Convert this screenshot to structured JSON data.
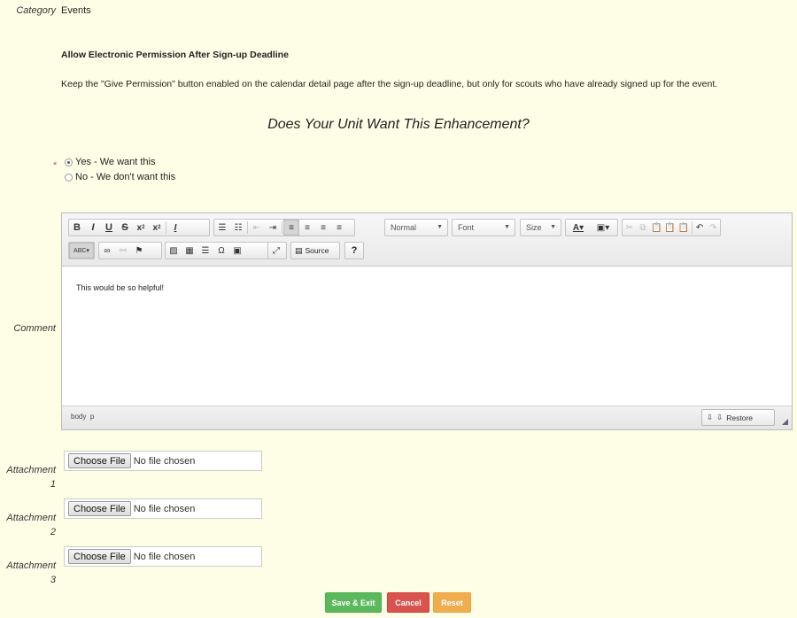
{
  "category": {
    "label": "Category",
    "value": "Events"
  },
  "enhancement": {
    "title": "Allow Electronic Permission After Sign-up Deadline",
    "description": "Keep the \"Give Permission\" button enabled on the calendar detail page after the sign-up deadline, but only for scouts who have already signed up for the event."
  },
  "question": "Does Your Unit Want This Enhancement?",
  "required_marker": "*",
  "options": [
    {
      "label": "Yes - We want this",
      "selected": true
    },
    {
      "label": "No - We don't want this",
      "selected": false
    }
  ],
  "comment": {
    "label": "Comment",
    "toolbar": {
      "format_combo": "Normal",
      "font_combo": "Font",
      "size_combo": "Size",
      "source_label": "Source",
      "help_label": "?",
      "buttons": [
        "bold",
        "italic",
        "underline",
        "strikethrough",
        "subscript",
        "superscript",
        "remove-format",
        "numbered-list",
        "bulleted-list",
        "outdent",
        "indent",
        "align-left",
        "align-center",
        "align-right",
        "justify",
        "text-color",
        "background-color",
        "cut",
        "copy",
        "paste",
        "paste-text",
        "paste-word",
        "undo",
        "redo",
        "spellcheck",
        "link",
        "unlink",
        "anchor",
        "image",
        "table",
        "horizontal-line",
        "special-char",
        "youtube",
        "maximize",
        "source",
        "help"
      ]
    },
    "body_text": "This would be so helpful!",
    "path": [
      "body",
      "p"
    ],
    "restore_label": "Restore"
  },
  "attachments": [
    {
      "label_line1": "Attachment",
      "label_line2": "1",
      "button": "Choose File",
      "status": "No file chosen"
    },
    {
      "label_line1": "Attachment",
      "label_line2": "2",
      "button": "Choose File",
      "status": "No file chosen"
    },
    {
      "label_line1": "Attachment",
      "label_line2": "3",
      "button": "Choose File",
      "status": "No file chosen"
    }
  ],
  "actions": {
    "save": "Save & Exit",
    "cancel": "Cancel",
    "reset": "Reset"
  },
  "colors": {
    "save": "#5cb85c",
    "cancel": "#d9534f",
    "reset": "#f0ad4e",
    "background": "#fefee7"
  }
}
